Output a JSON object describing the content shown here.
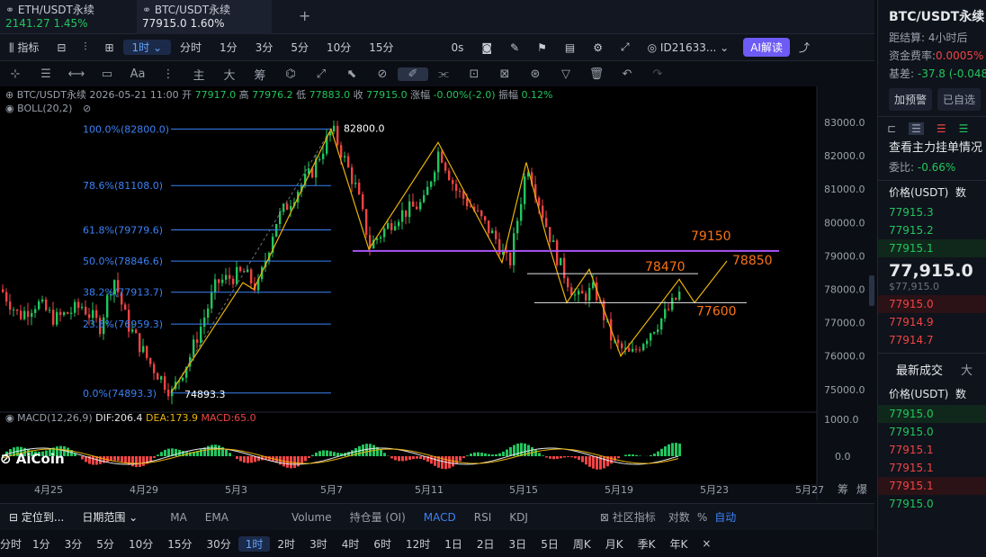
{
  "tabs": [
    {
      "symbol": "ETH/USDT永续",
      "price": "2141.27",
      "change": "1.45%"
    },
    {
      "symbol": "BTC/USDT永续",
      "price": "77915.0",
      "change": "1.60%"
    }
  ],
  "add_tab": "+",
  "toolbar": {
    "indicator": "指标",
    "interval": "1时",
    "intervals": [
      "分时",
      "1分",
      "3分",
      "5分",
      "10分",
      "15分"
    ],
    "zero_s": "0s",
    "account": "ID21633...",
    "ai": "AI解读"
  },
  "draw_toolbar": {
    "zhu": "主",
    "da": "大",
    "chou": "筹"
  },
  "ohlc": {
    "symbol": "BTC/USDT永续",
    "time": "2026-05-21 11:00",
    "open_l": "开",
    "open": "77917.0",
    "high_l": "高",
    "high": "77976.2",
    "low_l": "低",
    "low": "77883.0",
    "close_l": "收",
    "close": "77915.0",
    "chg_l": "涨幅",
    "chg": "-0.00%(-2.0)",
    "amp_l": "振幅",
    "amp": "0.12%",
    "boll": "BOLL(20,2)"
  },
  "fib": [
    {
      "label": "100.0%(82800.0)",
      "price": 82800
    },
    {
      "label": "78.6%(81108.0)",
      "price": 81108
    },
    {
      "label": "61.8%(79779.6)",
      "price": 79779.6
    },
    {
      "label": "50.0%(78846.6)",
      "price": 78846.6
    },
    {
      "label": "38.2%(77913.7)",
      "price": 77913.7
    },
    {
      "label": "23.6%(76959.3)",
      "price": 76959.3
    },
    {
      "label": "0.0%(74893.3)",
      "price": 74893.3
    }
  ],
  "annotations": {
    "high": "82800.0",
    "low": "74893.3",
    "l79150": "79150",
    "l78470": "78470",
    "l78850": "78850",
    "l77600": "77600"
  },
  "y_axis": [
    "83000.0",
    "82000.0",
    "81000.0",
    "80000.0",
    "79000.0",
    "78000.0",
    "77000.0",
    "76000.0",
    "75000.0"
  ],
  "macd": {
    "label": "MACD(12,26,9)",
    "dif": "DIF:206.4",
    "dea": "DEA:173.9",
    "macd": "MACD:65.0",
    "axis_top": "1000.0",
    "axis_zero": "0.0"
  },
  "x_axis": [
    "4月25",
    "4月29",
    "5月3",
    "5月7",
    "5月11",
    "5月15",
    "5月19",
    "5月23",
    "5月27"
  ],
  "x_right": [
    "筹",
    "爆"
  ],
  "logo": "AiCoin",
  "bottom_tools": {
    "locate": "定位到...",
    "range": "日期范围",
    "inds": [
      "MA",
      "EMA",
      "Volume",
      "持仓量 (OI)",
      "MACD",
      "RSI",
      "KDJ"
    ],
    "community": "社区指标",
    "log": "对数",
    "pct": "%",
    "auto": "自动"
  },
  "bottom_intervals": [
    "分时",
    "1分",
    "3分",
    "5分",
    "10分",
    "15分",
    "30分",
    "1时",
    "2时",
    "3时",
    "4时",
    "6时",
    "12时",
    "1日",
    "2日",
    "3日",
    "5日",
    "周K",
    "月K",
    "季K",
    "年K"
  ],
  "right": {
    "title": "BTC/USDT永续",
    "settle_l": "距结算:",
    "settle": "4小时后",
    "rate_l": "资金费率:",
    "rate": "0.0005%",
    "basis_l": "基差:",
    "basis": "-37.8 (-0.048",
    "alert": "加预警",
    "fav": "已自选",
    "orders_title": "查看主力挂单情况",
    "ratio_l": "委比:",
    "ratio": "-0.66%",
    "col_price": "价格(USDT)",
    "col_qty": "数",
    "asks": [
      "77915.3",
      "77915.2",
      "77915.1"
    ],
    "last": "77,915.0",
    "last_sub": "$77,915.0",
    "bids": [
      "77915.0",
      "77914.9",
      "77914.7"
    ],
    "trades_tab": "最新成交",
    "trades_tab2": "大",
    "trades": [
      {
        "p": "77915.0",
        "s": "up"
      },
      {
        "p": "77915.0",
        "s": "up"
      },
      {
        "p": "77915.1",
        "s": "down"
      },
      {
        "p": "77915.1",
        "s": "down"
      },
      {
        "p": "77915.1",
        "s": "down"
      },
      {
        "p": "77915.0",
        "s": "up"
      }
    ]
  },
  "colors": {
    "up": "#22c55e",
    "down": "#ef4444",
    "fib": "#3b82f6",
    "zigzag": "#eab308",
    "purple": "#a855f7",
    "orange": "#f97316"
  }
}
